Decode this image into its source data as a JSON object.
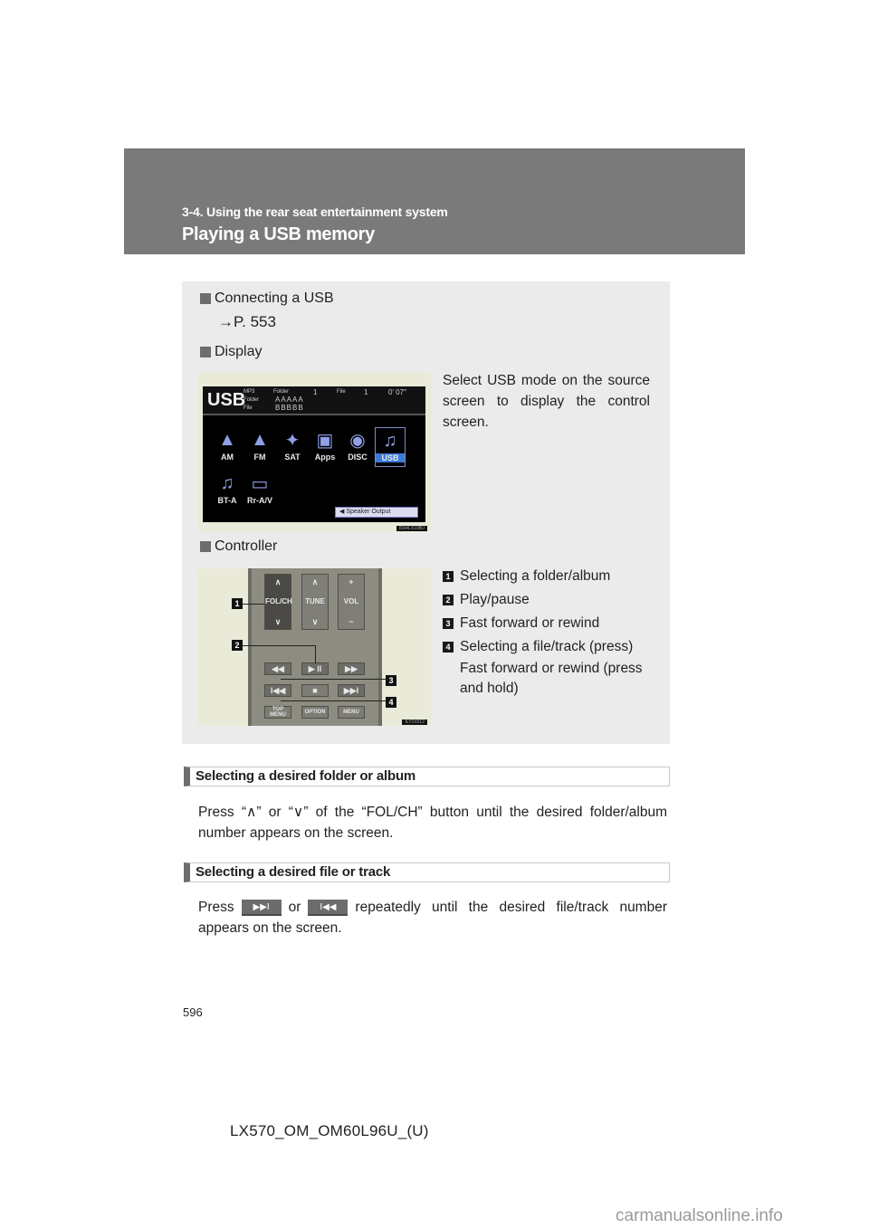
{
  "header": {
    "section": "3-4. Using the rear seat entertainment system",
    "title": "Playing a USB memory"
  },
  "info_box": {
    "connecting": {
      "heading": "Connecting a USB",
      "reference": "→P. 553"
    },
    "display": {
      "heading": "Display",
      "description": "Select USB mode on the source screen to display the control screen.",
      "screen": {
        "mode_label": "USB",
        "format": "MP3",
        "folder_label": "Folder",
        "folder_number": "1",
        "file_label": "File",
        "file_number": "1",
        "elapsed_time": "0′ 07″",
        "folder_name": "AAAAA",
        "file_name": "BBBBB",
        "sources": [
          {
            "label": "AM",
            "icon": "antenna-icon",
            "active": false
          },
          {
            "label": "FM",
            "icon": "antenna-icon",
            "active": false
          },
          {
            "label": "SAT",
            "icon": "satellite-icon",
            "active": false
          },
          {
            "label": "Apps",
            "icon": "apps-folder-icon",
            "active": false
          },
          {
            "label": "DISC",
            "icon": "disc-icon",
            "active": false
          },
          {
            "label": "USB",
            "icon": "music-note-icon",
            "active": true
          },
          {
            "label": "BT-A",
            "icon": "music-note-icon",
            "active": false
          },
          {
            "label": "Rr-A/V",
            "icon": "monitor-icon",
            "active": false
          }
        ],
        "speaker_output_label": "Speaker Output",
        "image_code": "IS54LX108U"
      }
    },
    "controller": {
      "heading": "Controller",
      "remote": {
        "fol_ch": "FOL/CH",
        "tune": "TUNE",
        "vol": "VOL",
        "up": "∧",
        "down": "∨",
        "plus": "+",
        "minus": "−",
        "rewind": "◀◀",
        "play_pause": "▶ II",
        "fast_forward": "▶▶",
        "prev_track": "I◀◀",
        "stop": "■",
        "next_track": "▶▶I",
        "top_menu": "TOP MENU",
        "option": "OPTION",
        "menu": "MENU",
        "image_code": "ILY2X012"
      },
      "legend": [
        {
          "number": "1",
          "text": "Selecting a folder/album"
        },
        {
          "number": "2",
          "text": "Play/pause"
        },
        {
          "number": "3",
          "text": "Fast forward or rewind"
        },
        {
          "number": "4",
          "text": "Selecting a file/track (press)"
        }
      ],
      "legend_continuation": "Fast forward or rewind (press and hold)"
    }
  },
  "sections": [
    {
      "heading": "Selecting a desired folder or album",
      "body": "Press “∧” or “∨” of the “FOL/CH” button until the desired folder/album number appears on the screen."
    },
    {
      "heading": "Selecting a desired file or track",
      "body_prefix": "Press",
      "body_or": "or",
      "body_suffix": "repeatedly until the desired file/track number appears on the screen.",
      "button_next": "▶▶I",
      "button_prev": "I◀◀"
    }
  ],
  "footer": {
    "page_number": "596",
    "doc_code": "LX570_OM_OM60L96U_(U)",
    "watermark": "carmanualsonline.info"
  }
}
